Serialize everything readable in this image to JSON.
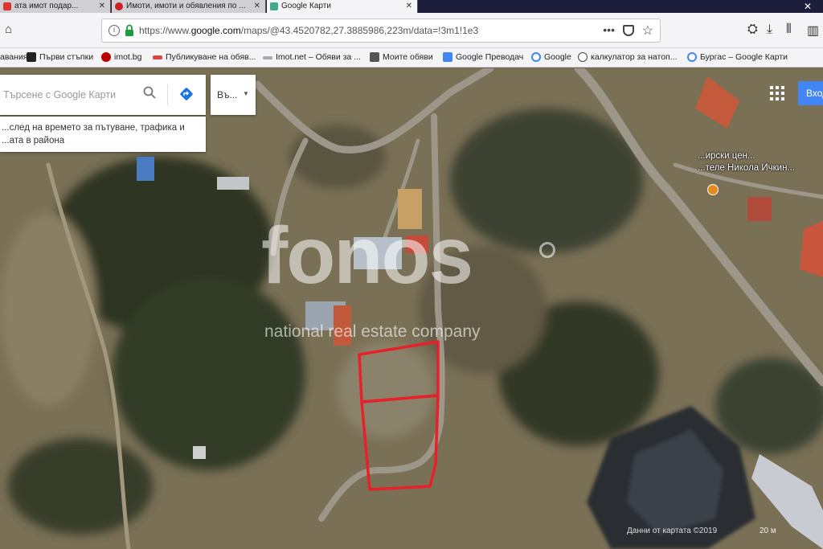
{
  "tabs": [
    {
      "label": "ата имот подар...",
      "icon_color": "#d33"
    },
    {
      "label": "Имоти, имоти и обявления по ...",
      "icon_color": "#c22"
    },
    {
      "label": "Google Карти",
      "icon_color": "#4a8"
    }
  ],
  "window": {
    "close_glyph": "✕"
  },
  "url": {
    "scheme": "https://www.",
    "host": "google.com",
    "path": "/maps/@43.4520782,27.3885986,223m/data=!3m1!1e3"
  },
  "bookmarks": [
    {
      "label": "авания",
      "color": "#888"
    },
    {
      "label": "Първи стъпки",
      "color": "#222"
    },
    {
      "label": "imot.bg",
      "color": "#b00"
    },
    {
      "label": "Публикуване на обяв...",
      "color": "#d44"
    },
    {
      "label": "Imot.net – Обяви за ...",
      "color": "#a0a0a0"
    },
    {
      "label": "Моите обяви",
      "color": "#555"
    },
    {
      "label": "Google Преводач",
      "color": "#4285f4"
    },
    {
      "label": "Google",
      "color": "#4285f4"
    },
    {
      "label": "калкулатор за натоп...",
      "color": "#444"
    },
    {
      "label": "Бургас – Google Карти",
      "color": "#4a8"
    }
  ],
  "search": {
    "placeholder": "Търсене с Google Карти"
  },
  "select": {
    "value": "Въ..."
  },
  "traffic_note": "...след на времето за пътуване, трафика и ...ата в района",
  "signin_label": "Вход",
  "poi": {
    "line1": "...ирски цен...",
    "line2": "...теле Никола Ичкин..."
  },
  "watermark": {
    "logo": "fonos",
    "tagline": "national real estate company"
  },
  "attribution": "Данни от картата ©2019",
  "scale_label": "20 м",
  "colors": {
    "plot_outline": "#e8202a",
    "accent": "#4285f4"
  }
}
